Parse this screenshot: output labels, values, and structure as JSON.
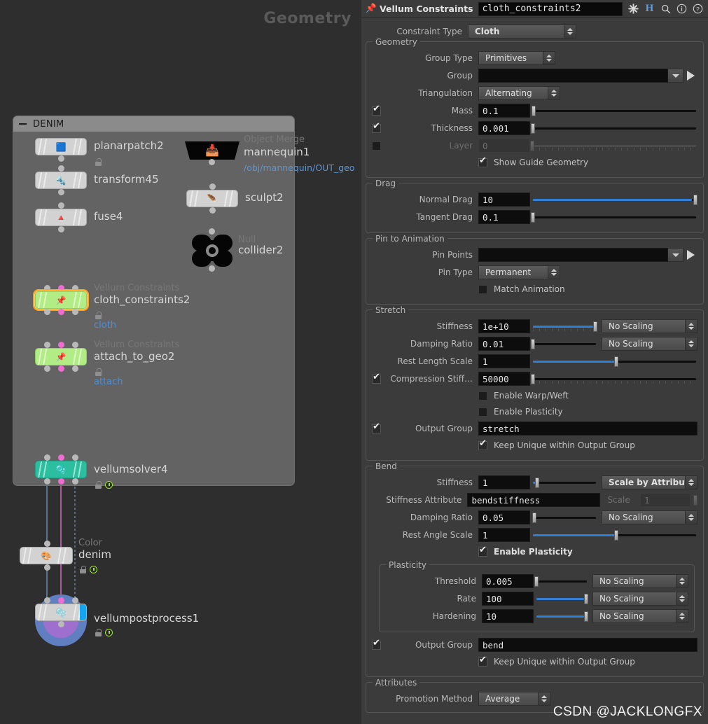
{
  "network": {
    "background_label": "Geometry",
    "box": {
      "title": "DENIM"
    },
    "nodes": [
      {
        "name": "planarpatch2",
        "type": "",
        "path": "",
        "group": "",
        "icon": "◆"
      },
      {
        "name": "transform45",
        "type": "",
        "path": "",
        "group": "",
        "icon": "✥"
      },
      {
        "name": "fuse4",
        "type": "",
        "path": "",
        "group": "",
        "icon": "✱"
      },
      {
        "name": "mannequin1",
        "type": "Object Merge",
        "path": "/obj/mannequin/OUT_geo",
        "group": "",
        "icon": "⧉"
      },
      {
        "name": "sculpt2",
        "type": "",
        "path": "",
        "group": "",
        "icon": "✎"
      },
      {
        "name": "collider2",
        "type": "Null",
        "path": "",
        "group": "",
        "icon": "◉"
      },
      {
        "name": "cloth_constraints2",
        "type": "Vellum Constraints",
        "path": "",
        "group": "cloth",
        "icon": "📌"
      },
      {
        "name": "attach_to_geo2",
        "type": "Vellum Constraints",
        "path": "",
        "group": "attach",
        "icon": "📌"
      },
      {
        "name": "vellumsolver4",
        "type": "",
        "path": "",
        "group": "",
        "icon": "◗"
      },
      {
        "name": "denim",
        "type": "Color",
        "path": "",
        "group": "",
        "icon": "🖌"
      },
      {
        "name": "vellumpostprocess1",
        "type": "",
        "path": "",
        "group": "",
        "icon": "◍"
      }
    ]
  },
  "params": {
    "header": {
      "node_type_label": "Vellum Constraints",
      "node_name": "cloth_constraints2",
      "icons": [
        "pin-icon",
        "gear-icon",
        "houdini-h-icon",
        "search-icon",
        "info-icon",
        "help-icon"
      ]
    },
    "constraint_type": {
      "label": "Constraint Type",
      "value": "Cloth"
    },
    "geometry": {
      "title": "Geometry",
      "group_type": {
        "label": "Group Type",
        "value": "Primitives"
      },
      "group": {
        "label": "Group",
        "value": ""
      },
      "triangulation": {
        "label": "Triangulation",
        "value": "Alternating"
      },
      "mass": {
        "label": "Mass",
        "value": "0.1",
        "checked": true,
        "slider_pct": 2
      },
      "thickness": {
        "label": "Thickness",
        "value": "0.001",
        "checked": true,
        "slider_pct": 0.5
      },
      "layer": {
        "label": "Layer",
        "value": "0",
        "checked": false,
        "slider_pct": 0,
        "disabled": true
      },
      "show_guide_geometry": {
        "label": "Show Guide Geometry",
        "checked": true
      }
    },
    "drag": {
      "title": "Drag",
      "normal_drag": {
        "label": "Normal Drag",
        "value": "10",
        "slider_pct": 99
      },
      "tangent_drag": {
        "label": "Tangent Drag",
        "value": "0.1",
        "slider_pct": 1
      }
    },
    "pin_to_animation": {
      "title": "Pin to Animation",
      "pin_points": {
        "label": "Pin Points",
        "value": ""
      },
      "pin_type": {
        "label": "Pin Type",
        "value": "Permanent"
      },
      "match_animation": {
        "label": "Match Animation",
        "checked": false
      }
    },
    "stretch": {
      "title": "Stretch",
      "stiffness": {
        "label": "Stiffness",
        "value": "1e+10",
        "slider_pct": 96,
        "scaling": "No Scaling"
      },
      "damping_ratio": {
        "label": "Damping Ratio",
        "value": "0.01",
        "slider_pct": 1,
        "scaling": "No Scaling"
      },
      "rest_length_scale": {
        "label": "Rest Length Scale",
        "value": "1",
        "slider_pct": 50
      },
      "compression_stiffness": {
        "label": "Compression Stiff…",
        "value": "50000",
        "checked": true,
        "slider_pct": 1
      },
      "enable_warp_weft": {
        "label": "Enable Warp/Weft",
        "checked": false
      },
      "enable_plasticity": {
        "label": "Enable Plasticity",
        "checked": false
      },
      "output_group": {
        "label": "Output Group",
        "value": "stretch",
        "checked": true
      },
      "keep_unique": {
        "label": "Keep Unique within Output Group",
        "checked": true
      }
    },
    "bend": {
      "title": "Bend",
      "stiffness": {
        "label": "Stiffness",
        "value": "1",
        "slider_pct": 4,
        "scaling": "Scale by Attribute"
      },
      "stiffness_attribute": {
        "label": "Stiffness Attribute",
        "value": "bendstiffness",
        "scale_label": "Scale",
        "scale_value": "1"
      },
      "damping_ratio": {
        "label": "Damping Ratio",
        "value": "0.05",
        "slider_pct": 2,
        "scaling": "No Scaling"
      },
      "rest_angle_scale": {
        "label": "Rest Angle Scale",
        "value": "1",
        "slider_pct": 50
      },
      "enable_plasticity": {
        "label": "Enable Plasticity",
        "checked": true
      },
      "plasticity": {
        "title": "Plasticity",
        "threshold": {
          "label": "Threshold",
          "value": "0.005",
          "slider_pct": 1,
          "scaling": "No Scaling"
        },
        "rate": {
          "label": "Rate",
          "value": "100",
          "slider_pct": 97,
          "scaling": "No Scaling"
        },
        "hardening": {
          "label": "Hardening",
          "value": "10",
          "slider_pct": 97,
          "scaling": "No Scaling"
        }
      },
      "output_group": {
        "label": "Output Group",
        "value": "bend",
        "checked": true
      },
      "keep_unique": {
        "label": "Keep Unique within Output Group",
        "checked": true
      }
    },
    "attributes": {
      "title": "Attributes",
      "promotion_method": {
        "label": "Promotion Method",
        "value": "Average"
      }
    },
    "watermark": "CSDN @JACKLONGFX"
  },
  "colors": {
    "accent_blue": "#2f7fd8",
    "selected_node": "#ffa31a",
    "vellum_green": "#b2ec85",
    "solver_teal": "#2bbfa0",
    "link_blue": "#5b94d6",
    "pane_bg": "#3b3b3b",
    "network_bg": "#2e2e2e"
  }
}
